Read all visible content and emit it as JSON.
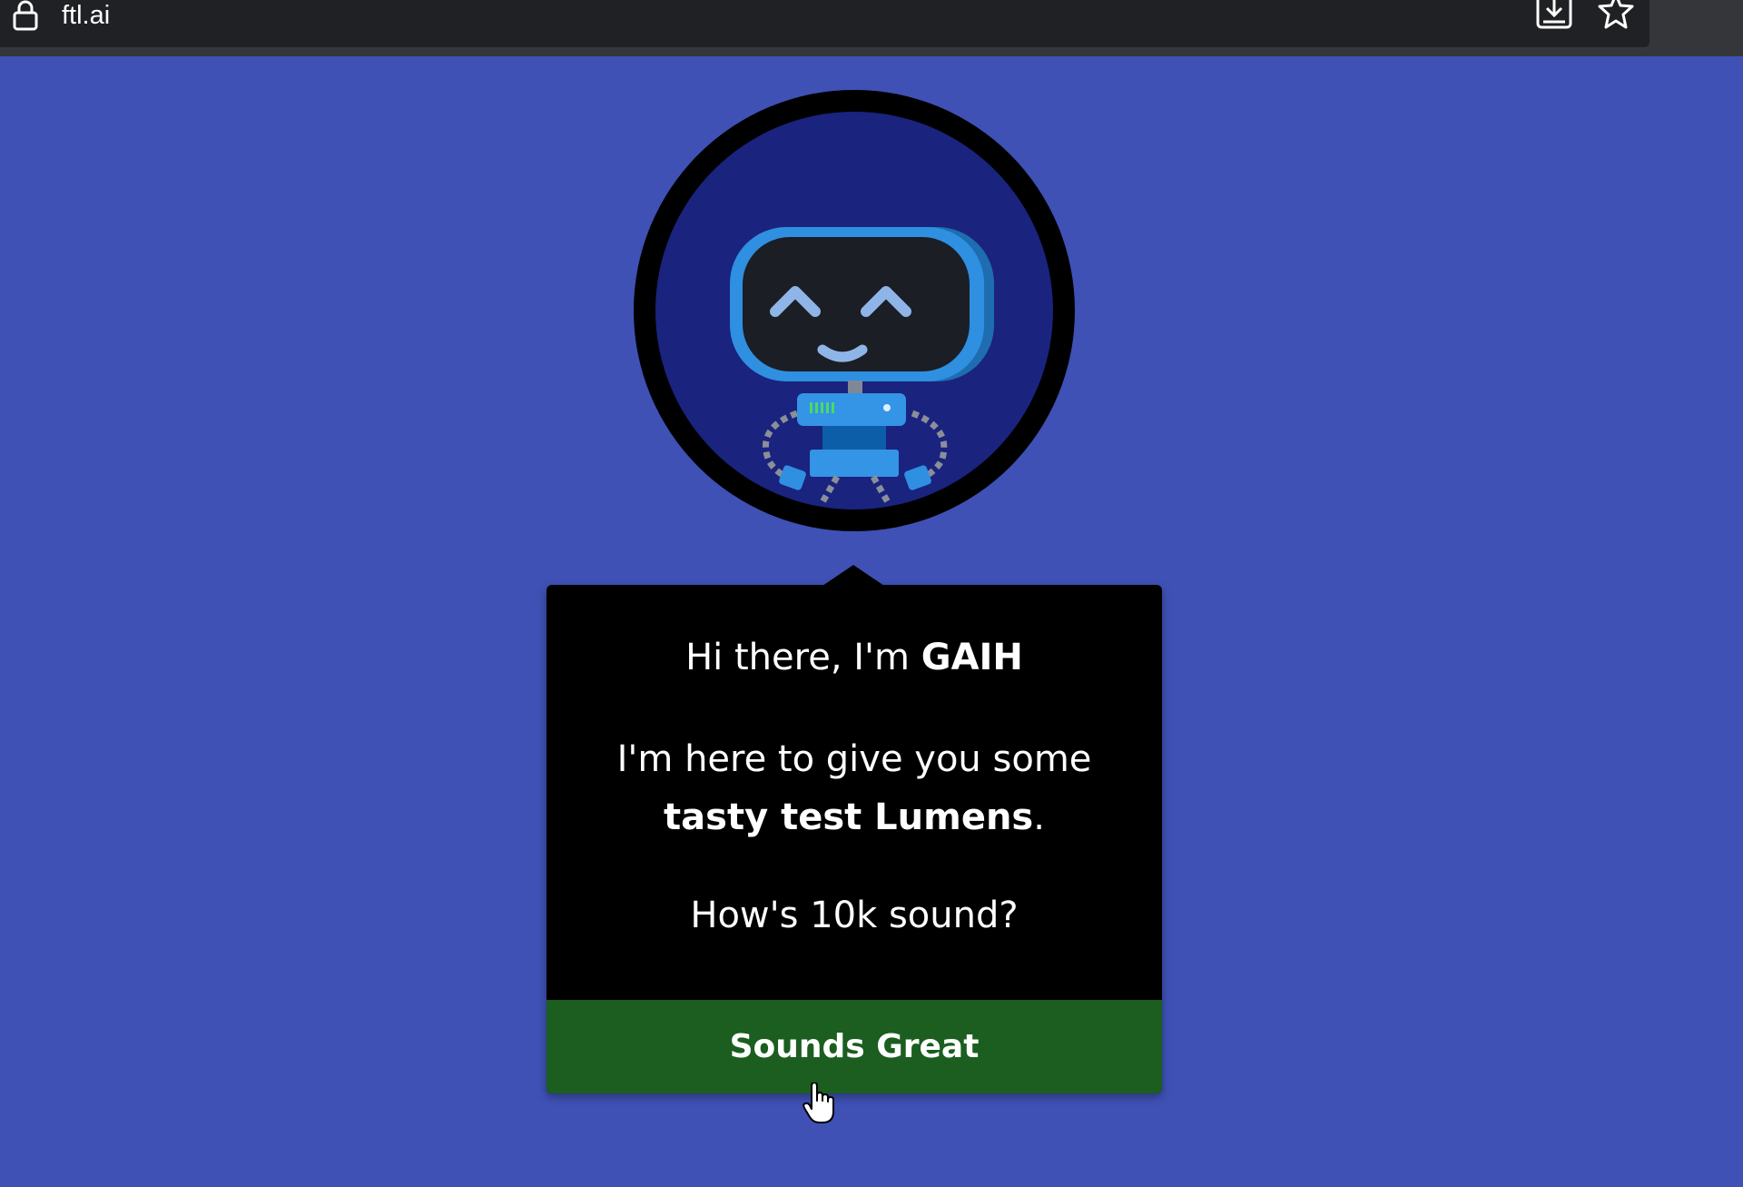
{
  "browser": {
    "url": "ftl.ai",
    "icons": [
      "lock-icon",
      "install-app-icon",
      "bookmark-star-icon"
    ]
  },
  "avatar": {
    "icon": "robot-avatar-icon"
  },
  "card": {
    "greeting_prefix": "Hi there, I'm ",
    "bot_name": "GAIH",
    "line2": "I'm here to give you some",
    "highlight": "tasty test Lumens",
    "line2_suffix": ".",
    "question": "How's 10k sound?",
    "button_label": "Sounds Great"
  },
  "colors": {
    "page_background": "#3f51b5",
    "card_background": "#000000",
    "button_background": "#1b5e20",
    "avatar_background": "#1a237e"
  }
}
